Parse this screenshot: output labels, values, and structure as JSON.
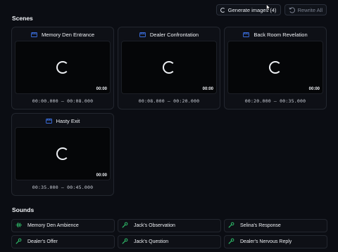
{
  "toolbar": {
    "generate_label": "Generate images (4)",
    "rewrite_label": "Rewrite All"
  },
  "colors": {
    "accent": "#3b6fe0",
    "sound_icon": "#2fbf6b",
    "background": "#0b0d13"
  },
  "scenes_title": "Scenes",
  "scenes": [
    {
      "title": "Memory Den Entrance",
      "duration": "00:00",
      "range": "00:00.000 — 00:08.000"
    },
    {
      "title": "Dealer Confrontation",
      "duration": "00:00",
      "range": "00:08.000 — 00:20.000"
    },
    {
      "title": "Back Room Revelation",
      "duration": "00:00",
      "range": "00:20.000 — 00:35.000"
    },
    {
      "title": "Hasty Exit",
      "duration": "00:00",
      "range": "00:35.000 — 00:45.000"
    }
  ],
  "sounds_title": "Sounds",
  "sounds": [
    {
      "label": "Memory Den Ambience",
      "icon": "waveform-icon"
    },
    {
      "label": "Jack's Observation",
      "icon": "microphone-icon"
    },
    {
      "label": "Selina's Response",
      "icon": "microphone-icon"
    },
    {
      "label": "Dealer's Offer",
      "icon": "microphone-icon"
    },
    {
      "label": "Jack's Question",
      "icon": "microphone-icon"
    },
    {
      "label": "Dealer's Nervous Reply",
      "icon": "microphone-icon"
    }
  ]
}
